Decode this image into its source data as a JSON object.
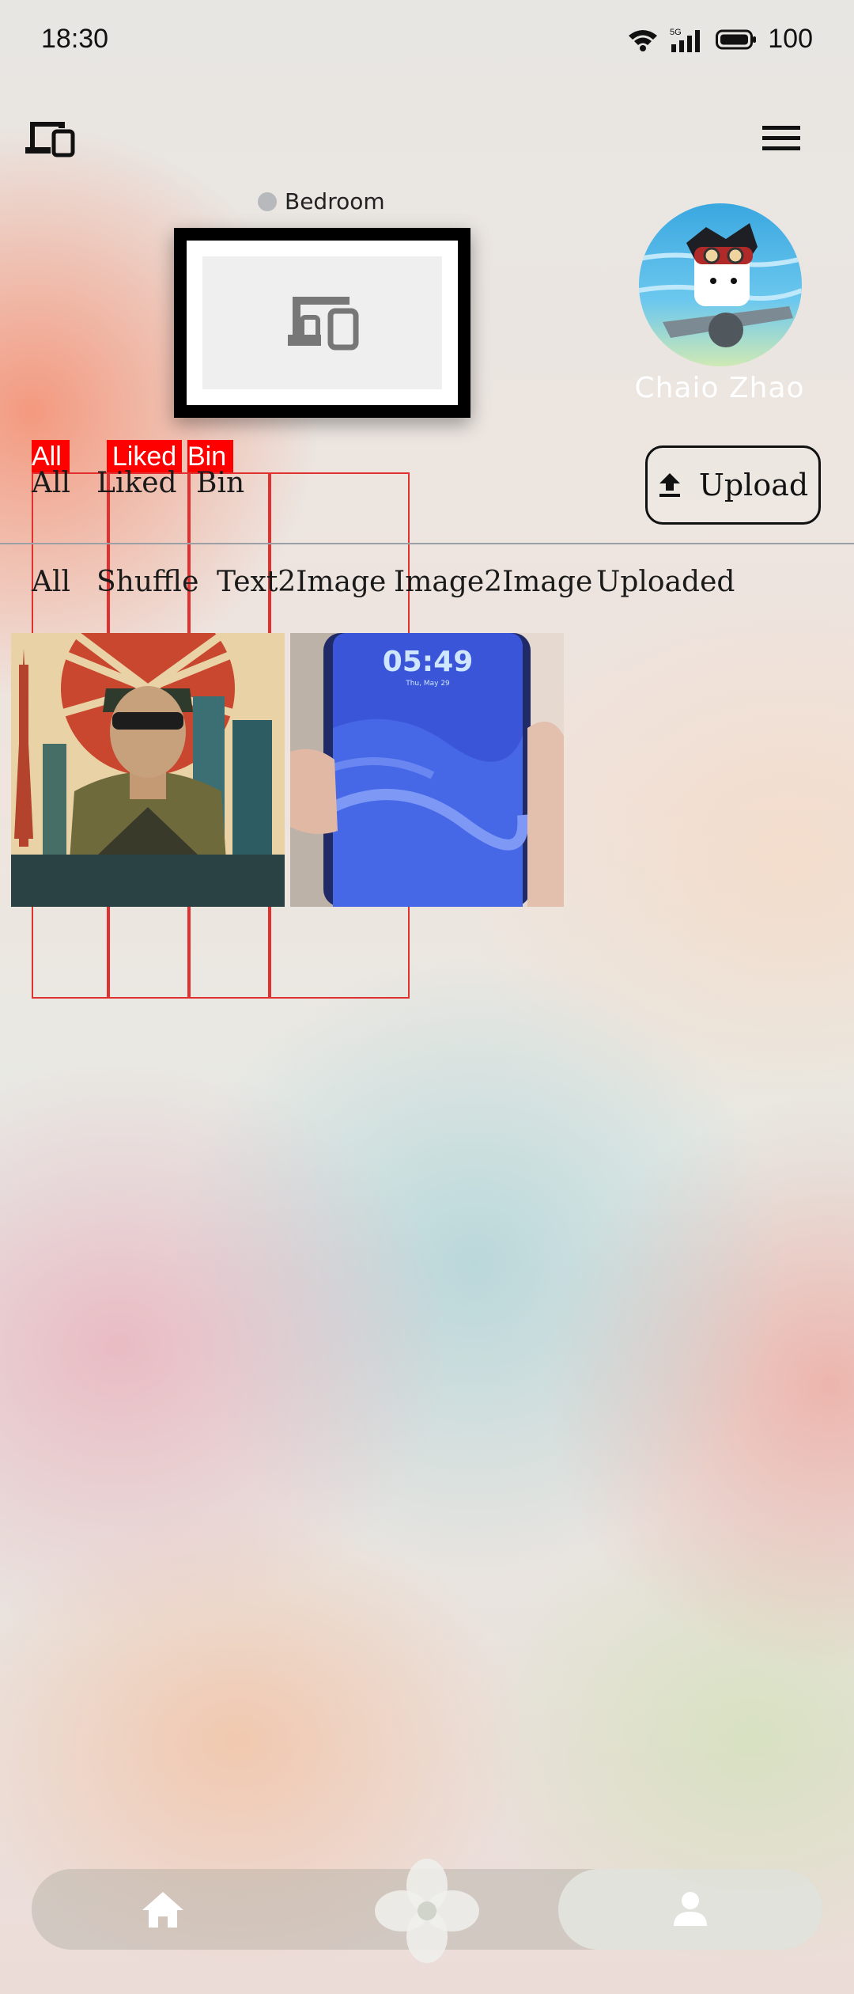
{
  "status_bar": {
    "time": "18:30",
    "network": "5G",
    "battery": "100"
  },
  "top_bar": {
    "devices_icon": "devices-icon",
    "menu_icon": "hamburger-menu-icon"
  },
  "frame_device": {
    "room": "Bedroom",
    "placeholder_icon": "devices-icon"
  },
  "profile": {
    "name": "Chaio Zhao"
  },
  "debug_labels": [
    "All",
    "Liked",
    "Bin"
  ],
  "filter_tabs": [
    "All",
    "Liked",
    "Bin"
  ],
  "upload": {
    "label": "Upload",
    "icon": "upload-icon"
  },
  "category_tabs": [
    "All",
    "Shuffle",
    "Text2Image",
    "Image2Image",
    "Uploaded"
  ],
  "gallery": [
    {
      "icon": "poster-image",
      "clock": ""
    },
    {
      "icon": "phone-photo-image",
      "clock": "05:49",
      "date": "Thu, May 29"
    }
  ],
  "bottom_nav": {
    "home_icon": "home-icon",
    "center_icon": "flower-icon",
    "profile_icon": "person-icon"
  },
  "colors": {
    "debug_red": "#ff0000",
    "text": "#1a1a1a",
    "white": "#ffffff"
  }
}
